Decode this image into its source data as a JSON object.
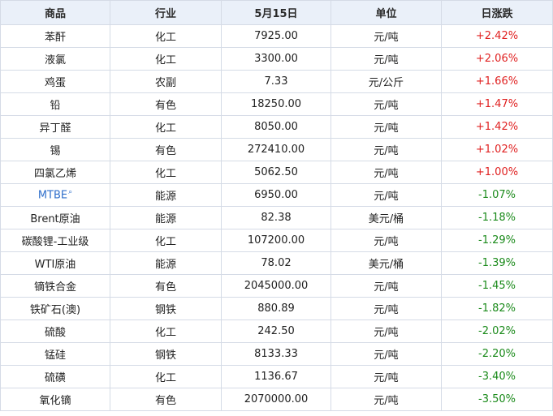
{
  "headers": {
    "product": "商品",
    "industry": "行业",
    "date": "5月15日",
    "unit": "单位",
    "change": "日涨跌"
  },
  "colors": {
    "up": "#e02020",
    "down": "#1a8a1a",
    "link": "#2f6fcb",
    "header_bg": "#eaf0f9"
  },
  "rows": [
    {
      "name": "苯酐",
      "industry": "化工",
      "price": "7925.00",
      "unit": "元/吨",
      "change": "+2.42%",
      "direction": "up"
    },
    {
      "name": "液氯",
      "industry": "化工",
      "price": "3300.00",
      "unit": "元/吨",
      "change": "+2.06%",
      "direction": "up"
    },
    {
      "name": "鸡蛋",
      "industry": "农副",
      "price": "7.33",
      "unit": "元/公斤",
      "change": "+1.66%",
      "direction": "up"
    },
    {
      "name": "铅",
      "industry": "有色",
      "price": "18250.00",
      "unit": "元/吨",
      "change": "+1.47%",
      "direction": "up"
    },
    {
      "name": "异丁醛",
      "industry": "化工",
      "price": "8050.00",
      "unit": "元/吨",
      "change": "+1.42%",
      "direction": "up"
    },
    {
      "name": "锡",
      "industry": "有色",
      "price": "272410.00",
      "unit": "元/吨",
      "change": "+1.02%",
      "direction": "up"
    },
    {
      "name": "四氯乙烯",
      "industry": "化工",
      "price": "5062.50",
      "unit": "元/吨",
      "change": "+1.00%",
      "direction": "up"
    },
    {
      "name": "MTBE",
      "industry": "能源",
      "price": "6950.00",
      "unit": "元/吨",
      "change": "-1.07%",
      "direction": "down",
      "link": true,
      "link_icon": "search-icon"
    },
    {
      "name": "Brent原油",
      "industry": "能源",
      "price": "82.38",
      "unit": "美元/桶",
      "change": "-1.18%",
      "direction": "down"
    },
    {
      "name": "碳酸锂-工业级",
      "industry": "化工",
      "price": "107200.00",
      "unit": "元/吨",
      "change": "-1.29%",
      "direction": "down"
    },
    {
      "name": "WTI原油",
      "industry": "能源",
      "price": "78.02",
      "unit": "美元/桶",
      "change": "-1.39%",
      "direction": "down"
    },
    {
      "name": "镝铁合金",
      "industry": "有色",
      "price": "2045000.00",
      "unit": "元/吨",
      "change": "-1.45%",
      "direction": "down"
    },
    {
      "name": "铁矿石(澳)",
      "industry": "钢铁",
      "price": "880.89",
      "unit": "元/吨",
      "change": "-1.82%",
      "direction": "down"
    },
    {
      "name": "硫酸",
      "industry": "化工",
      "price": "242.50",
      "unit": "元/吨",
      "change": "-2.02%",
      "direction": "down"
    },
    {
      "name": "锰硅",
      "industry": "钢铁",
      "price": "8133.33",
      "unit": "元/吨",
      "change": "-2.20%",
      "direction": "down"
    },
    {
      "name": "硫磺",
      "industry": "化工",
      "price": "1136.67",
      "unit": "元/吨",
      "change": "-3.40%",
      "direction": "down"
    },
    {
      "name": "氧化镝",
      "industry": "有色",
      "price": "2070000.00",
      "unit": "元/吨",
      "change": "-3.50%",
      "direction": "down"
    }
  ]
}
